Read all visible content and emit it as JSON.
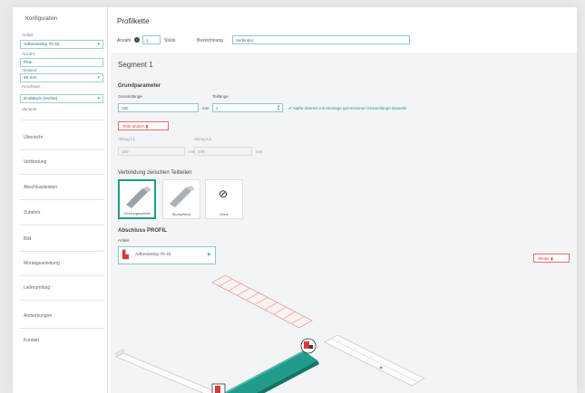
{
  "sidebar": {
    "heading": "Konfiguration",
    "field1_label": "Artikel",
    "field1_value": "Adhesivstrip 70 40",
    "field2_label": "Anzahl",
    "field2_value": "Plan",
    "field3_label": "Abstand",
    "field3_value": "40 mm",
    "field4_label": "Anschluss",
    "field4_value": "Endstück (rechts)",
    "field5_label": "Variante",
    "links": [
      "Übersicht",
      "Verbindung",
      "Abschlussleisten",
      "Zubehör",
      "Bild",
      "Montageanleitung",
      "Lieferumfang",
      "Anmerkungen",
      "Kontakt"
    ]
  },
  "profile": {
    "title": "Profilkette",
    "count_label": "Anzahl",
    "count_value": "1",
    "unit_label": "Stück",
    "name_label": "Bezeichnung",
    "name_value": "Verbinder"
  },
  "segment": {
    "title": "Segment 1",
    "basic_section": "Grundparameter",
    "length_label": "Gesamtlänge",
    "length_value": "100",
    "length_unit": "mm",
    "parts_label": "Teillänge",
    "parts_value": "1",
    "hint": "Maße überein mit Montage gemessener Gesamtlänge Bauteile",
    "delete_button": "Teile ändern",
    "x1_label": "Abzug L1",
    "x1_value": "100",
    "x1_unit": "mm",
    "x2_label": "Abzug L2",
    "x2_value": "100",
    "x2_unit": "mm",
    "connection_section": "Verbindung zwischen Teilteilen",
    "tiles": [
      "Gehrungsschnitt",
      "Stumpfstoß",
      "Ohne"
    ],
    "end_section": "Abschluss PROFIL",
    "end_label": "Artikel",
    "end_value": "Adhesivstrip 70 40",
    "remove_button": "Weiter"
  }
}
